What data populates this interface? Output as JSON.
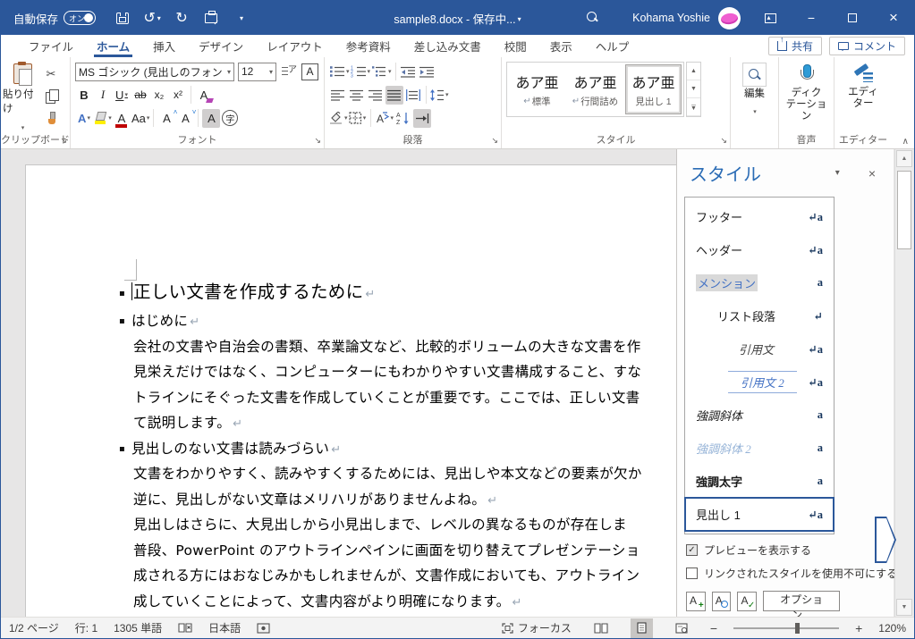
{
  "colors": {
    "accent": "#2b579a",
    "titlebar": "#2b579a",
    "selected_toggle": "#d0cece",
    "status_selected": "#c8c6c4"
  },
  "titlebar": {
    "autosave_label": "自動保存",
    "autosave_state": "オン",
    "doc_title": "sample8.docx - 保存中...",
    "user_name": "Kohama Yoshie"
  },
  "tabs": [
    {
      "label": "ファイル",
      "cls": ""
    },
    {
      "label": "ホーム",
      "cls": "active"
    },
    {
      "label": "挿入",
      "cls": ""
    },
    {
      "label": "デザイン",
      "cls": ""
    },
    {
      "label": "レイアウト",
      "cls": ""
    },
    {
      "label": "参考資料",
      "cls": ""
    },
    {
      "label": "差し込み文書",
      "cls": ""
    },
    {
      "label": "校閲",
      "cls": ""
    },
    {
      "label": "表示",
      "cls": ""
    },
    {
      "label": "ヘルプ",
      "cls": ""
    }
  ],
  "actions": {
    "share": "共有",
    "comments": "コメント"
  },
  "ribbon": {
    "clipboard": {
      "paste": "貼り付け",
      "label": "クリップボード"
    },
    "font": {
      "name": "MS ゴシック (見出しのフォント",
      "size": "12",
      "label": "フォント",
      "glyphs": {
        "bold": "B",
        "italic": "I",
        "underline": "U",
        "strike": "ab",
        "sub": "x₂",
        "sup": "x²",
        "clear": "A",
        "effects": "A",
        "fontcolor": "A",
        "case": "Aa",
        "grow": "A",
        "shrink": "A",
        "shade": "A",
        "enclose": "字",
        "border": "A"
      }
    },
    "paragraph": {
      "label": "段落",
      "ext_glyph": "A",
      "sort_a": "A",
      "sort_z": "Z"
    },
    "styles": {
      "label": "スタイル",
      "gallery": [
        {
          "preview": "あア亜",
          "mark": "↵",
          "name": "標準",
          "cls": ""
        },
        {
          "preview": "あア亜",
          "mark": "↵",
          "name": "行間詰め",
          "cls": ""
        },
        {
          "preview": "あア亜",
          "mark": null,
          "name": "見出し 1",
          "cls": "sel"
        }
      ]
    },
    "editing": {
      "label": "編集"
    },
    "voice": {
      "button": "ディク\nテーション",
      "label": "音声"
    },
    "editor": {
      "button": "エディ\nター",
      "label": "エディター"
    }
  },
  "styles_pane": {
    "title": "スタイル",
    "items": [
      {
        "label": "フッター",
        "marker": "↵a",
        "cls": ""
      },
      {
        "label": "ヘッダー",
        "marker": "↵a",
        "cls": ""
      },
      {
        "label": "メンション",
        "marker": "a",
        "cls": "s-mention"
      },
      {
        "label": "リスト段落",
        "marker": "↵",
        "cls": "s-list"
      },
      {
        "label": "引用文",
        "marker": "↵a",
        "cls": "s-quote"
      },
      {
        "label": "引用文 2",
        "marker": "↵a",
        "cls": "s-quote2"
      },
      {
        "label": "強調斜体",
        "marker": "a",
        "cls": "s-em-i"
      },
      {
        "label": "強調斜体 2",
        "marker": "a",
        "cls": "s-em-i2"
      },
      {
        "label": "強調太字",
        "marker": "a",
        "cls": "s-em-b"
      },
      {
        "label": "見出し 1",
        "marker": "↵a",
        "cls": "s-h1 sel"
      }
    ],
    "show_preview": {
      "label": "プレビューを表示する",
      "checked": true
    },
    "disable_linked": {
      "label": "リンクされたスタイルを使用不可にする",
      "checked": false
    },
    "options_button": "オプション..."
  },
  "document": {
    "lines": [
      {
        "cls": "h1",
        "bullet": "▪",
        "cursor": "",
        "text": "正しい文書を作成するために",
        "mark": "↵"
      },
      {
        "cls": "h2",
        "bullet": "▪",
        "text": "はじめに",
        "mark": "↵"
      },
      {
        "cls": "body",
        "text": "会社の文書や自治会の書類、卒業論文など、比較的ボリュームの大きな文書を作"
      },
      {
        "cls": "body",
        "text": "見栄えだけではなく、コンピューターにもわかりやすい文書構成すること、すな"
      },
      {
        "cls": "body",
        "text": "トラインにそぐった文書を作成していくことが重要です。ここでは、正しい文書"
      },
      {
        "cls": "body",
        "text": "て説明します。",
        "mark": "↵"
      },
      {
        "cls": "h2",
        "bullet": "▪",
        "text": "見出しのない文書は読みづらい",
        "mark": "↵"
      },
      {
        "cls": "body",
        "text": "文書をわかりやすく、読みやすくするためには、見出しや本文などの要素が欠か"
      },
      {
        "cls": "body",
        "text": "逆に、見出しがない文章はメリハリがありませんよね。",
        "mark": "↵"
      },
      {
        "cls": "body",
        "text": "見出しはさらに、大見出しから小見出しまで、レベルの異なるものが存在しま"
      },
      {
        "cls": "body",
        "text": "普段、PowerPoint のアウトラインペインに画面を切り替えてプレゼンテーショ"
      },
      {
        "cls": "body",
        "text": "成される方にはおなじみかもしれませんが、文書作成においても、アウトライン"
      },
      {
        "cls": "body",
        "text": "成していくことによって、文書内容がより明確になります。",
        "mark": "↵"
      }
    ]
  },
  "status_bar": {
    "page": "1/2 ページ",
    "line": "行: 1",
    "words": "1305 単語",
    "language": "日本語",
    "focus": "フォーカス",
    "zoom": "120%"
  }
}
